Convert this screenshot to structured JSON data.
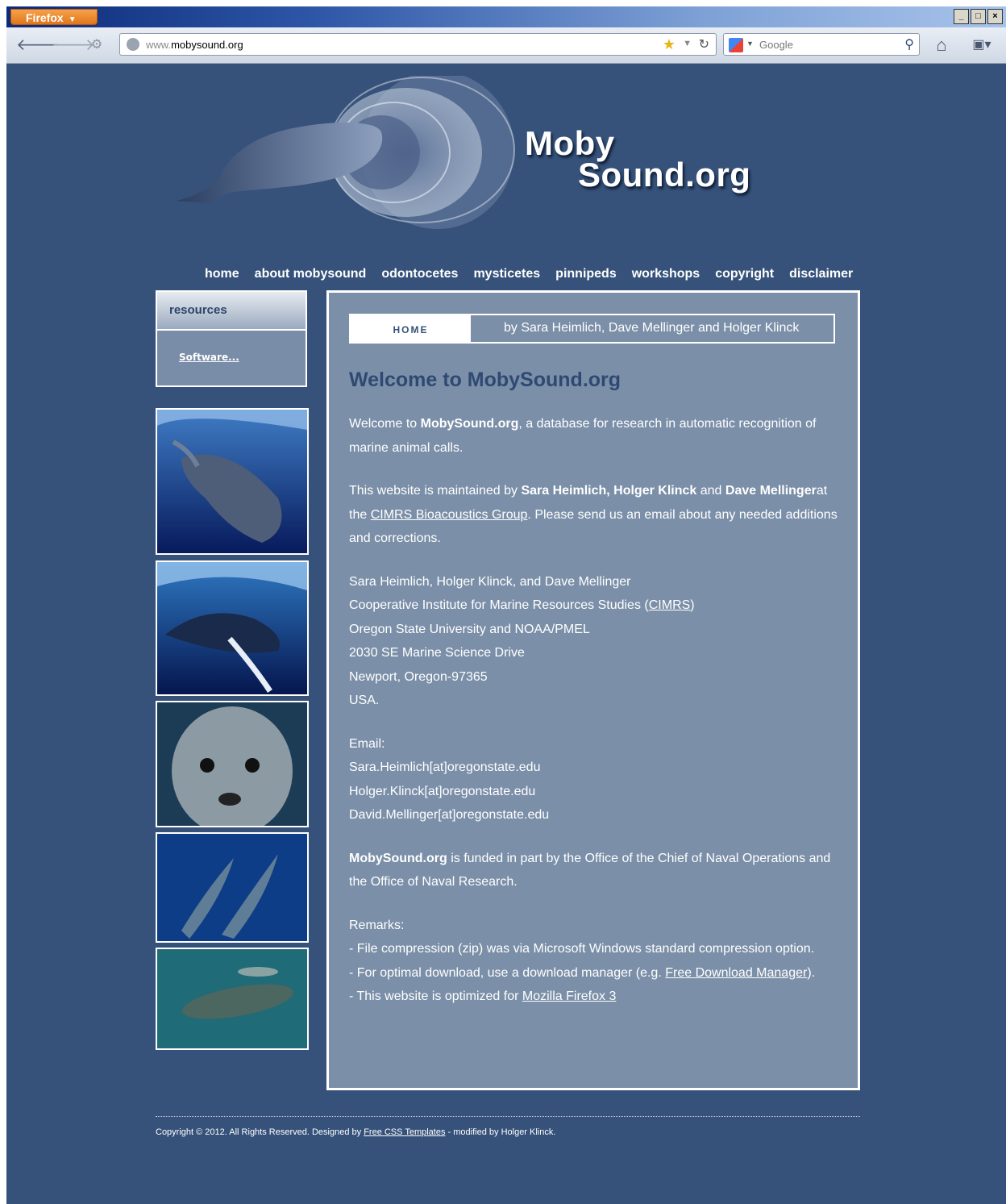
{
  "browser": {
    "app_button": "Firefox",
    "window_buttons": [
      "_",
      "□",
      "×"
    ],
    "url_prefix": "www.",
    "url_domain": "mobysound.org",
    "search_placeholder": "Google"
  },
  "site": {
    "logo_line1": "Moby",
    "logo_line2": "Sound.org",
    "menu": [
      "home",
      "about mobysound",
      "odontocetes",
      "mysticetes",
      "pinnipeds",
      "workshops",
      "copyright",
      "disclaimer"
    ],
    "sidebar": {
      "heading": "resources",
      "link": "Software..."
    },
    "tab": {
      "active": "HOME",
      "byline": "by Sara Heimlich, Dave Mellinger and Holger Klinck"
    },
    "welcome_title": "Welcome to MobySound.org",
    "p1": {
      "a": "Welcome to ",
      "b": "MobySound.org",
      "c": ", a database for research in automatic recognition of marine animal calls."
    },
    "p2": {
      "a": "This website is maintained by ",
      "b": "Sara Heimlich, Holger Klinck",
      "c": " and ",
      "d": "Dave Mellinger",
      "e": "at the ",
      "link": "CIMRS Bioacoustics Group",
      "f": ". Please send us an email about any needed additions and corrections."
    },
    "address": {
      "l1": "Sara Heimlich, Holger Klinck, and Dave Mellinger",
      "l2a": "Cooperative Institute for Marine Resources Studies (",
      "l2link": "CIMRS",
      "l2b": ")",
      "l3": "Oregon State University and NOAA/PMEL",
      "l4": "2030 SE Marine Science Drive",
      "l5": "Newport, Oregon-97365",
      "l6": "USA."
    },
    "email": {
      "label": "Email:",
      "e1": "Sara.Heimlich[at]oregonstate.edu",
      "e2": "Holger.Klinck[at]oregonstate.edu",
      "e3": "David.Mellinger[at]oregonstate.edu"
    },
    "funding": {
      "b": "MobySound.org",
      "c": " is funded in part by the Office of the Chief of Naval Operations and the Office of Naval Research."
    },
    "remarks": {
      "label": "Remarks:",
      "r1": "- File compression (zip) was via Microsoft Windows standard compression option.",
      "r2a": "- For optimal download, use a download manager (e.g. ",
      "r2link": "Free Download Manager",
      "r2b": ").",
      "r3a": "- This website is optimized for ",
      "r3link": "Mozilla Firefox 3"
    },
    "footer": {
      "a": "Copyright © 2012. All Rights Reserved. Designed by ",
      "link": "Free CSS Templates",
      "b": " - modified by Holger Klinck."
    }
  },
  "colors": {
    "page_bg": "#36527a",
    "content_bg": "#7b8fa8",
    "title_blue": "#2f4a72"
  },
  "icons": [
    "back-icon",
    "forward-icon",
    "history-icon",
    "globe-icon",
    "bookmark-star-icon",
    "reload-icon",
    "google-icon",
    "search-icon",
    "home-icon",
    "bookmarks-menu-icon"
  ]
}
